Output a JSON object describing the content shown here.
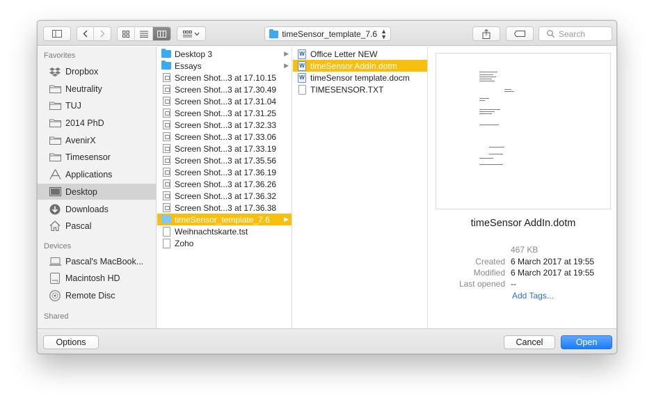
{
  "toolbar": {
    "path_label": "timeSensor_template_7.6",
    "search_placeholder": "Search"
  },
  "sidebar": {
    "favorites_heading": "Favorites",
    "favorites": [
      {
        "label": "Dropbox",
        "icon": "dropbox-icon"
      },
      {
        "label": "Neutrality",
        "icon": "folder-icon"
      },
      {
        "label": "TUJ",
        "icon": "folder-icon"
      },
      {
        "label": "2014 PhD",
        "icon": "folder-icon"
      },
      {
        "label": "AvenirX",
        "icon": "folder-icon"
      },
      {
        "label": "Timesensor",
        "icon": "folder-icon"
      },
      {
        "label": "Applications",
        "icon": "applications-icon"
      },
      {
        "label": "Desktop",
        "icon": "desktop-icon",
        "selected": true
      },
      {
        "label": "Downloads",
        "icon": "downloads-icon"
      },
      {
        "label": "Pascal",
        "icon": "home-icon"
      }
    ],
    "devices_heading": "Devices",
    "devices": [
      {
        "label": "Pascal's MacBook...",
        "icon": "laptop-icon"
      },
      {
        "label": "Macintosh HD",
        "icon": "disk-icon"
      },
      {
        "label": "Remote Disc",
        "icon": "disc-icon"
      }
    ],
    "shared_heading": "Shared"
  },
  "column1": [
    {
      "label": "Desktop 3",
      "kind": "folder",
      "chevron": true
    },
    {
      "label": "Essays",
      "kind": "folder",
      "chevron": true
    },
    {
      "label": "Screen Shot...3 at 17.10.15",
      "kind": "screenshot"
    },
    {
      "label": "Screen Shot...3 at 17.30.49",
      "kind": "screenshot"
    },
    {
      "label": "Screen Shot...3 at 17.31.04",
      "kind": "screenshot"
    },
    {
      "label": "Screen Shot...3 at 17.31.25",
      "kind": "screenshot"
    },
    {
      "label": "Screen Shot...3 at 17.32.33",
      "kind": "screenshot"
    },
    {
      "label": "Screen Shot...3 at 17.33.06",
      "kind": "screenshot"
    },
    {
      "label": "Screen Shot...3 at 17.33.19",
      "kind": "screenshot"
    },
    {
      "label": "Screen Shot...3 at 17.35.56",
      "kind": "screenshot"
    },
    {
      "label": "Screen Shot...3 at 17.36.19",
      "kind": "screenshot"
    },
    {
      "label": "Screen Shot...3 at 17.36.26",
      "kind": "screenshot"
    },
    {
      "label": "Screen Shot...3 at 17.36.32",
      "kind": "screenshot"
    },
    {
      "label": "Screen Shot...3 at 17.36.38",
      "kind": "screenshot"
    },
    {
      "label": "timeSensor_template_7.6",
      "kind": "folder",
      "chevron": true,
      "selected": true
    },
    {
      "label": "Weihnachtskarte.tst",
      "kind": "doc"
    },
    {
      "label": "Zoho",
      "kind": "doc"
    }
  ],
  "column2": [
    {
      "label": "Office Letter NEW",
      "kind": "word"
    },
    {
      "label": "timeSensor AddIn.dotm",
      "kind": "word",
      "selected": true
    },
    {
      "label": "timeSensor template.docm",
      "kind": "word"
    },
    {
      "label": "TIMESENSOR.TXT",
      "kind": "doc"
    }
  ],
  "preview": {
    "file_name": "timeSensor AddIn.dotm",
    "size": "467 KB",
    "created_label": "Created",
    "created_value": "6 March 2017 at 19:55",
    "modified_label": "Modified",
    "modified_value": "6 March 2017 at 19:55",
    "last_opened_label": "Last opened",
    "last_opened_value": "--",
    "add_tags": "Add Tags..."
  },
  "bottombar": {
    "options_label": "Options",
    "cancel_label": "Cancel",
    "open_label": "Open"
  },
  "colors": {
    "selection": "#f7bf10",
    "folder": "#3fa9ef",
    "primary_button": "#1a7cf6",
    "link": "#2d6fd7"
  }
}
